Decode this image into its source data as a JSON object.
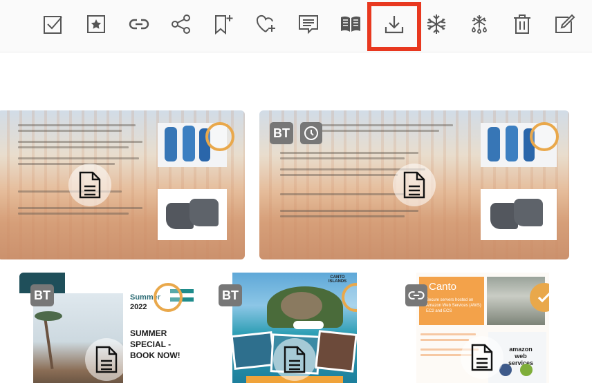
{
  "toolbar": {
    "buttons": [
      {
        "name": "select-all-icon"
      },
      {
        "name": "favorite-icon"
      },
      {
        "name": "link-icon"
      },
      {
        "name": "share-icon"
      },
      {
        "name": "bookmark-add-icon"
      },
      {
        "name": "heart-add-icon"
      },
      {
        "name": "comment-icon"
      },
      {
        "name": "book-icon"
      },
      {
        "name": "download-icon"
      },
      {
        "name": "freeze-icon"
      },
      {
        "name": "unfreeze-icon"
      },
      {
        "name": "delete-icon"
      },
      {
        "name": "edit-icon"
      }
    ],
    "highlighted": "download-icon",
    "highlight_color": "#e8381f"
  },
  "cards": [
    {
      "id": "card-1",
      "badges": [],
      "selected": false
    },
    {
      "id": "card-2",
      "badges": [
        "BT",
        "clock-icon"
      ],
      "selected": false
    },
    {
      "id": "card-3",
      "badges": [
        "BT"
      ],
      "selected": false,
      "flyer": {
        "title_top": "Summer",
        "year": "2022",
        "headline": "SUMMER SPECIAL - BOOK NOW!"
      }
    },
    {
      "id": "card-4",
      "badges": [
        "BT"
      ],
      "selected": false,
      "flyer": {
        "brand": "CANTO ISLANDS"
      }
    },
    {
      "id": "card-5",
      "badges": [
        "link-icon"
      ],
      "selected": true,
      "flyer": {
        "brand": "Canto",
        "text": "Secure servers hosted on Amazon Web Services (AWS) EC2 and ECS",
        "logo": "amazon web services"
      }
    }
  ],
  "accent_color": "#e9a84b",
  "badge_color": "#777777"
}
